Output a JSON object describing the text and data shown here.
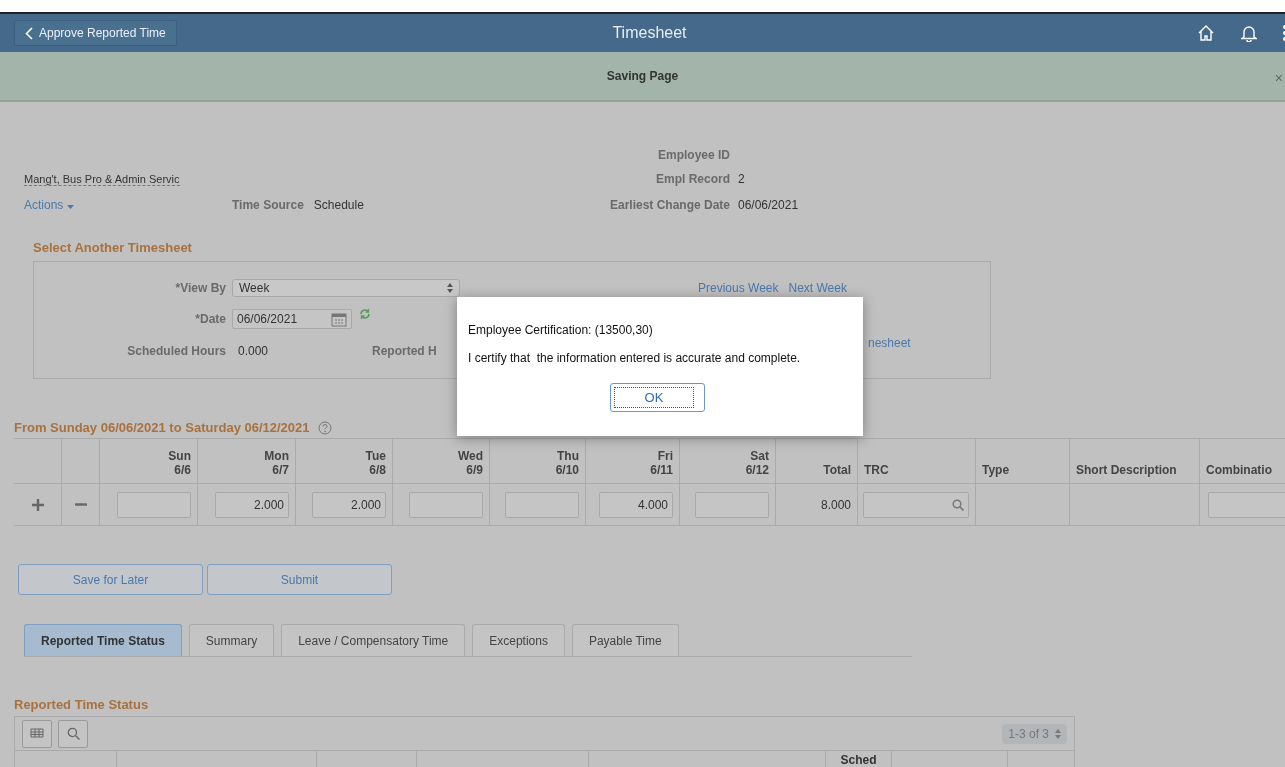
{
  "header": {
    "back_button": "Approve Reported Time",
    "title": "Timesheet"
  },
  "banner": {
    "message": "Saving Page",
    "close": "×"
  },
  "employee": {
    "department": "Mang't, Bus Pro & Admin Servic",
    "actions": "Actions",
    "fields": [
      {
        "label": "Employee ID"
      },
      {
        "label": "Empl Record",
        "value": "2"
      },
      {
        "label": "Earliest Change Date",
        "value": "06/06/2021"
      }
    ],
    "time_source": {
      "label": "Time Source",
      "value": "Schedule"
    }
  },
  "select_timesheet": {
    "title": "Select Another Timesheet",
    "view_by": {
      "label": "*View By",
      "value": "Week"
    },
    "date": {
      "label": "*Date",
      "value": "06/06/2021"
    },
    "scheduled_hours": {
      "label": "Scheduled Hours",
      "value": "0.000"
    },
    "reported_hours_label": "Reported H",
    "links": [
      "Previous Week",
      "Next Week"
    ],
    "timesheet_link": "nesheet"
  },
  "week": {
    "title": "From Sunday 06/06/2021 to Saturday 06/12/2021",
    "days": [
      {
        "day": "Sun",
        "date": "6/6"
      },
      {
        "day": "Mon",
        "date": "6/7",
        "hours": "2.000"
      },
      {
        "day": "Tue",
        "date": "6/8",
        "hours": "2.000"
      },
      {
        "day": "Wed",
        "date": "6/9"
      },
      {
        "day": "Thu",
        "date": "6/10"
      },
      {
        "day": "Fri",
        "date": "6/11",
        "hours": "4.000"
      },
      {
        "day": "Sat",
        "date": "6/12"
      }
    ],
    "columns": [
      "Total",
      "TRC",
      "Type",
      "Short Description",
      "Combinatio"
    ],
    "total": "8.000"
  },
  "buttons": [
    "Save for Later",
    "Submit"
  ],
  "tabs": [
    {
      "label": "Reported Time Status",
      "selected": true
    },
    {
      "label": "Summary",
      "selected": false
    },
    {
      "label": "Leave / Compensatory Time",
      "selected": false
    },
    {
      "label": "Exceptions",
      "selected": false
    },
    {
      "label": "Payable Time",
      "selected": false
    }
  ],
  "status_grid": {
    "title": "Reported Time Status",
    "pager": "1-3 of 3",
    "column_header": "Sched"
  },
  "dialog": {
    "title": "Employee Certification: (13500,30)",
    "message": "I certify that  the information entered is accurate and complete.",
    "ok": "OK"
  }
}
